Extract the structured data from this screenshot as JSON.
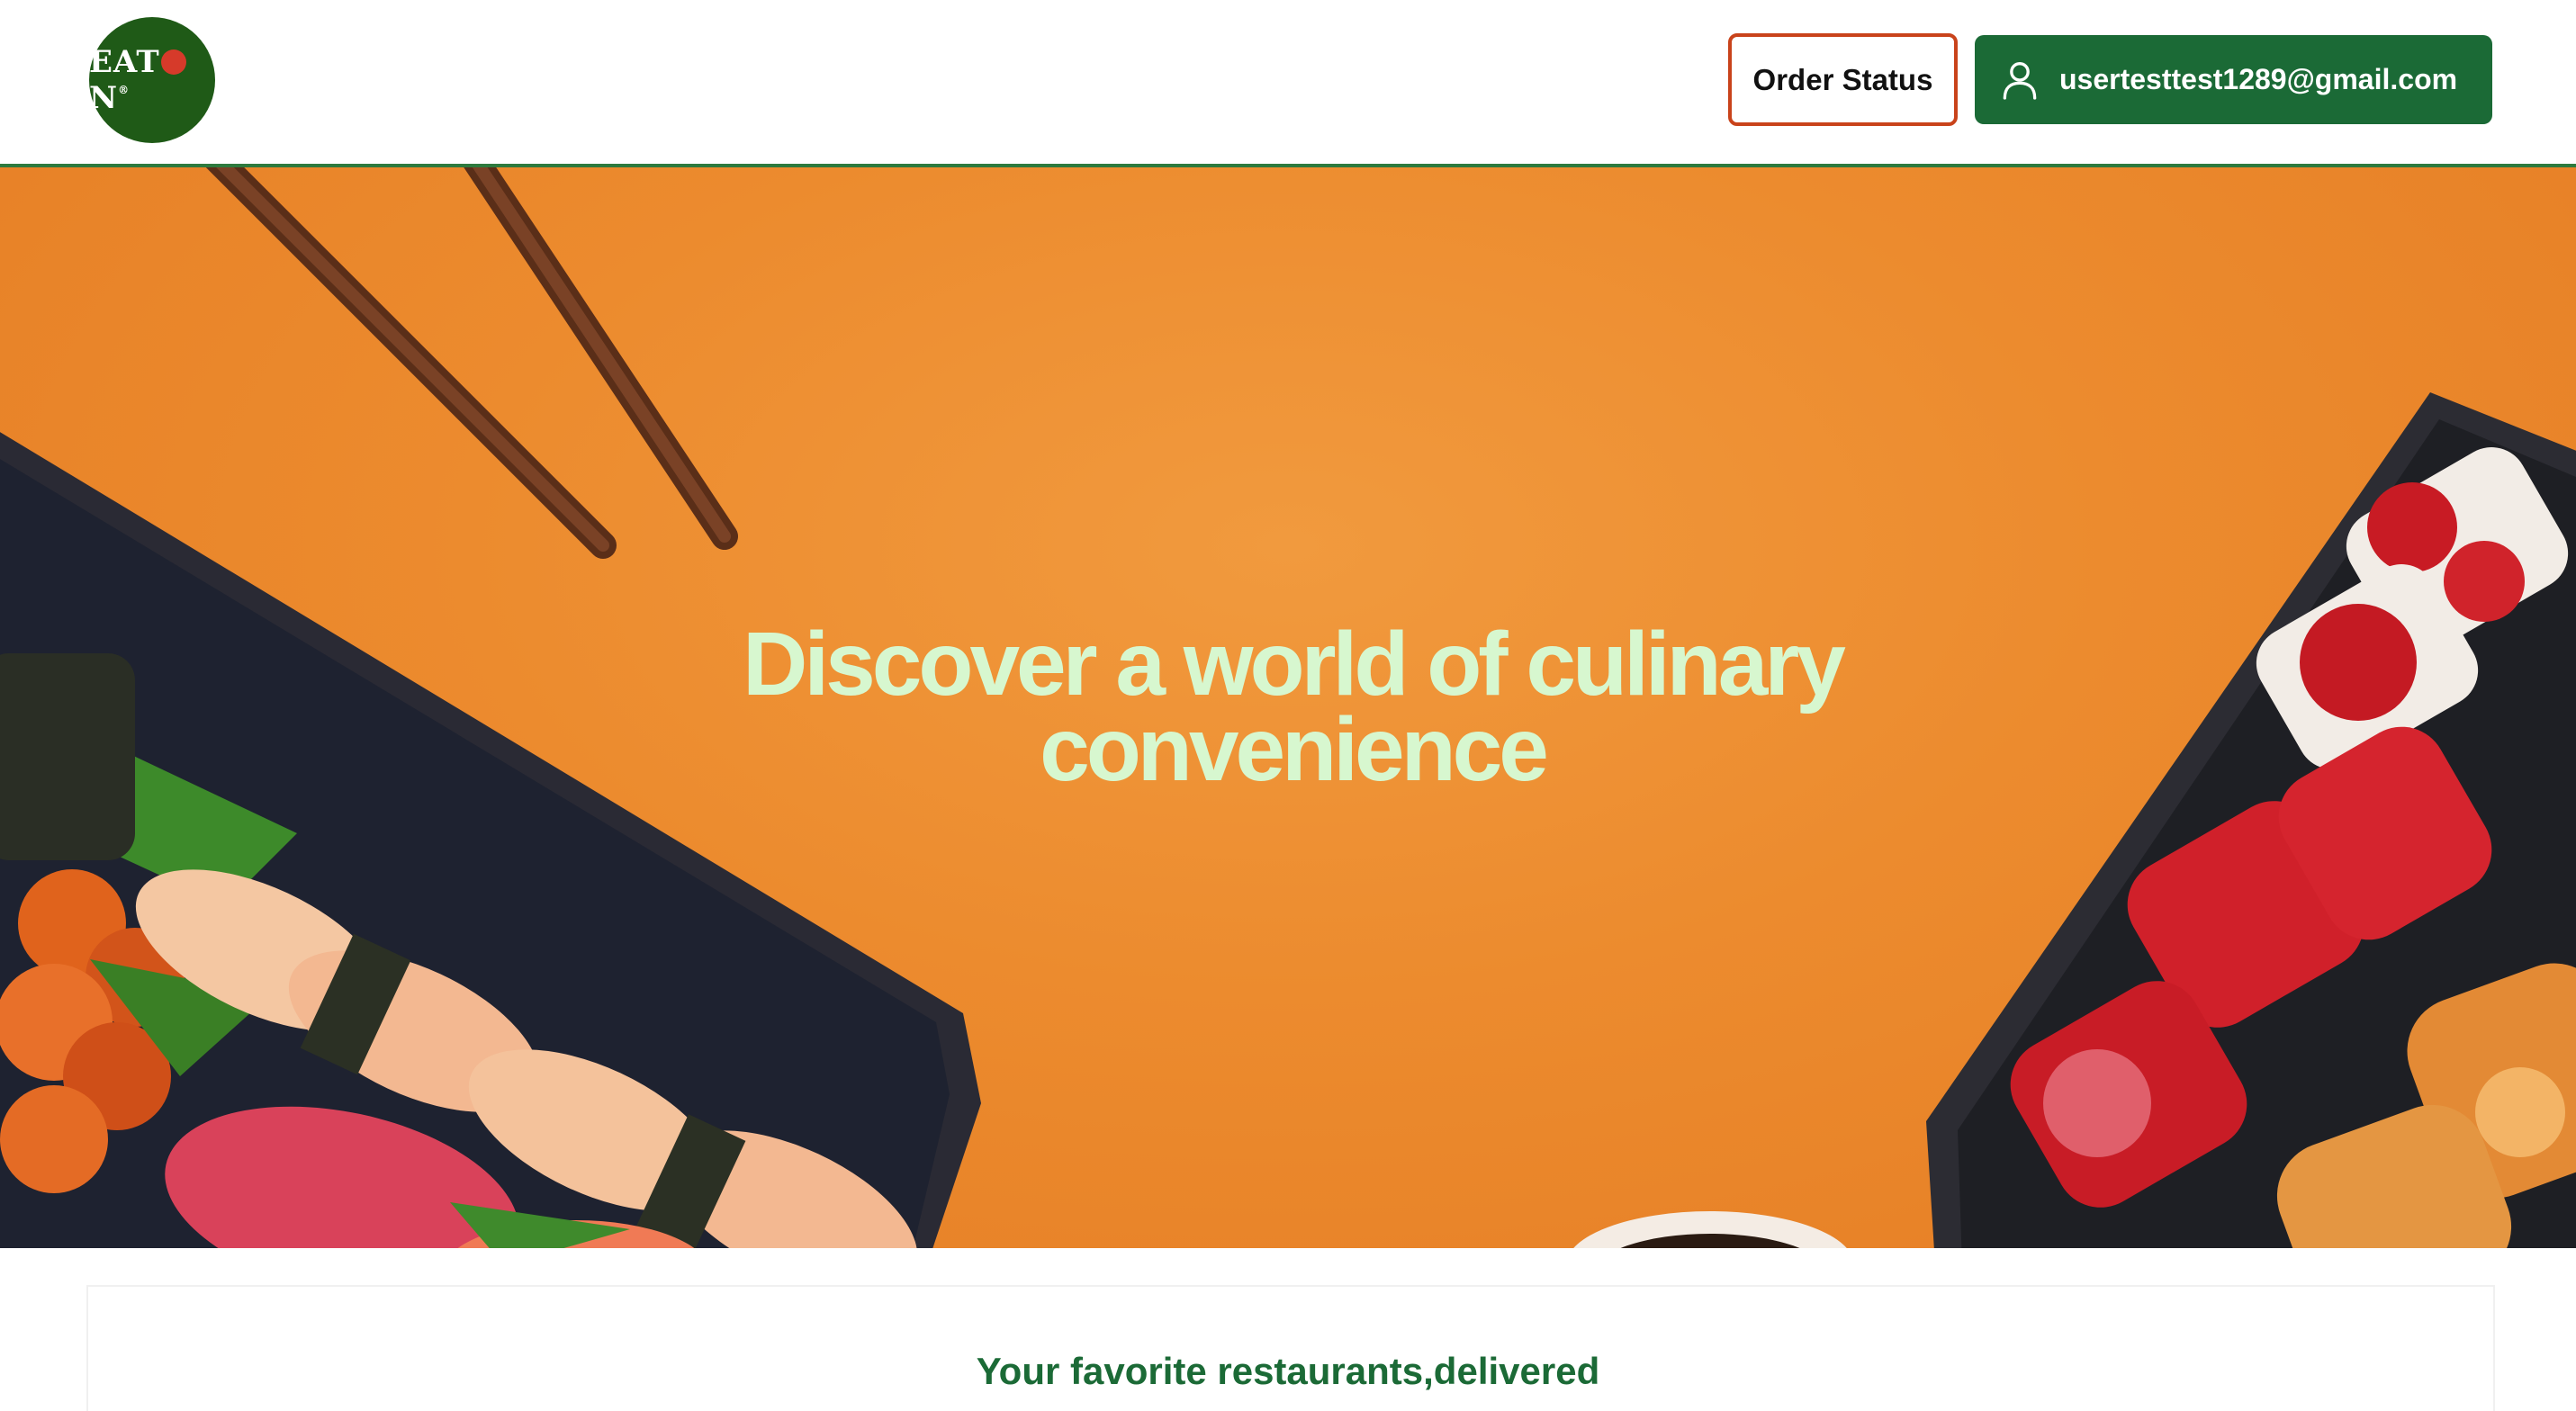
{
  "header": {
    "logo_text_left": "EAT",
    "logo_text_right": "N",
    "logo_tm": "®",
    "order_status_label": "Order Status",
    "user_email": "usertesttest1289@gmail.com"
  },
  "hero": {
    "title": "Discover a world of culinary convenience"
  },
  "section": {
    "tagline": "Your favorite restaurants,delivered"
  },
  "colors": {
    "brand_green": "#1b6a36",
    "accent_orange": "#c9431b",
    "hero_orange": "#ec8b2e",
    "hero_text": "#d7f7cf"
  },
  "icons": [
    "user-icon"
  ]
}
